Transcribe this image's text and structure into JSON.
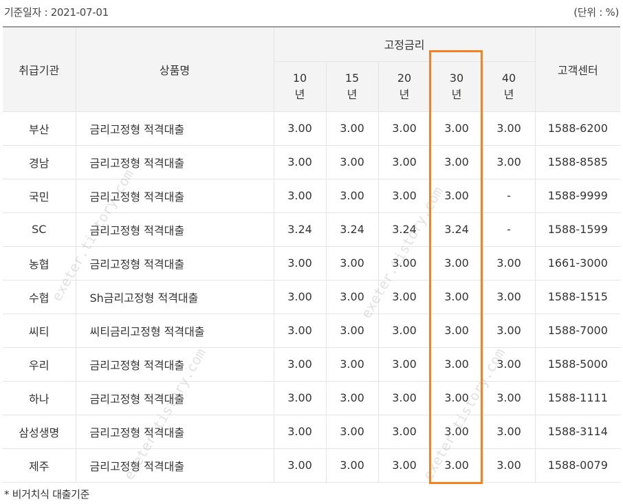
{
  "header": {
    "base_date": "기준일자 : 2021-07-01",
    "unit": "(단위 : %)"
  },
  "table": {
    "col_institution": "취급기관",
    "col_product": "상품명",
    "col_fixed_rate": "고정금리",
    "col_center": "고객센터",
    "terms": [
      {
        "num": "10",
        "unit": "년"
      },
      {
        "num": "15",
        "unit": "년"
      },
      {
        "num": "20",
        "unit": "년"
      },
      {
        "num": "30",
        "unit": "년"
      },
      {
        "num": "40",
        "unit": "년"
      }
    ],
    "rows": [
      {
        "bank": "부산",
        "product": "금리고정형 적격대출",
        "r10": "3.00",
        "r15": "3.00",
        "r20": "3.00",
        "r30": "3.00",
        "r40": "3.00",
        "phone": "1588-6200"
      },
      {
        "bank": "경남",
        "product": "금리고정형 적격대출",
        "r10": "3.00",
        "r15": "3.00",
        "r20": "3.00",
        "r30": "3.00",
        "r40": "3.00",
        "phone": "1588-8585"
      },
      {
        "bank": "국민",
        "product": "금리고정형 적격대출",
        "r10": "3.00",
        "r15": "3.00",
        "r20": "3.00",
        "r30": "3.00",
        "r40": "-",
        "phone": "1588-9999"
      },
      {
        "bank": "SC",
        "product": "금리고정형 적격대출",
        "r10": "3.24",
        "r15": "3.24",
        "r20": "3.24",
        "r30": "3.24",
        "r40": "-",
        "phone": "1588-1599"
      },
      {
        "bank": "농협",
        "product": "금리고정형 적격대출",
        "r10": "3.00",
        "r15": "3.00",
        "r20": "3.00",
        "r30": "3.00",
        "r40": "3.00",
        "phone": "1661-3000"
      },
      {
        "bank": "수협",
        "product": "Sh금리고정형 적격대출",
        "r10": "3.00",
        "r15": "3.00",
        "r20": "3.00",
        "r30": "3.00",
        "r40": "3.00",
        "phone": "1588-1515"
      },
      {
        "bank": "씨티",
        "product": "씨티금리고정형 적격대출",
        "r10": "3.00",
        "r15": "3.00",
        "r20": "3.00",
        "r30": "3.00",
        "r40": "3.00",
        "phone": "1588-7000"
      },
      {
        "bank": "우리",
        "product": "금리고정형 적격대출",
        "r10": "3.00",
        "r15": "3.00",
        "r20": "3.00",
        "r30": "3.00",
        "r40": "3.00",
        "phone": "1588-5000"
      },
      {
        "bank": "하나",
        "product": "금리고정형 적격대출",
        "r10": "3.00",
        "r15": "3.00",
        "r20": "3.00",
        "r30": "3.00",
        "r40": "3.00",
        "phone": "1588-1111"
      },
      {
        "bank": "삼성생명",
        "product": "금리고정형 적격대출",
        "r10": "3.00",
        "r15": "3.00",
        "r20": "3.00",
        "r30": "3.00",
        "r40": "3.00",
        "phone": "1588-3114"
      },
      {
        "bank": "제주",
        "product": "금리고정형 적격대출",
        "r10": "3.00",
        "r15": "3.00",
        "r20": "3.00",
        "r30": "3.00",
        "r40": "3.00",
        "phone": "1588-0079"
      }
    ]
  },
  "footnote": "* 비거치식 대출기준",
  "watermark": "exeter.tistory.com",
  "colors": {
    "highlight": "#f58220",
    "header_bg": "#f4f4f4"
  }
}
